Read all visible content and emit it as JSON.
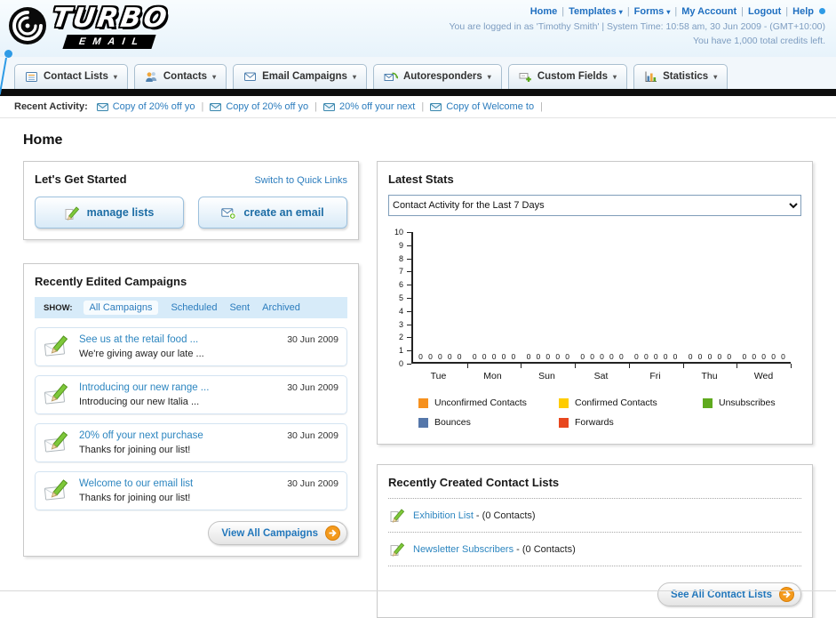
{
  "header": {
    "logo": {
      "title": "TURBO",
      "subtitle": "EMAIL"
    },
    "links": [
      {
        "label": "Home"
      },
      {
        "label": "Templates",
        "dropdown": true
      },
      {
        "label": "Forms",
        "dropdown": true
      },
      {
        "label": "My Account"
      },
      {
        "label": "Logout"
      },
      {
        "label": "Help"
      }
    ],
    "login_info": "You are logged in as 'Timothy Smith' | System Time: 10:58 am, 30 Jun 2009 - (GMT+10:00)",
    "credits_info": "You have 1,000 total credits left."
  },
  "nav": {
    "items": [
      {
        "label": "Contact Lists",
        "icon": "contact-lists"
      },
      {
        "label": "Contacts",
        "icon": "contacts"
      },
      {
        "label": "Email Campaigns",
        "icon": "email-campaigns"
      },
      {
        "label": "Autoresponders",
        "icon": "autoresponders"
      },
      {
        "label": "Custom Fields",
        "icon": "custom-fields"
      },
      {
        "label": "Statistics",
        "icon": "statistics"
      }
    ]
  },
  "recent_activity": {
    "label": "Recent Activity:",
    "items": [
      "Copy of 20% off yo",
      "Copy of 20% off yo",
      "20% off your next",
      "Copy of Welcome to"
    ]
  },
  "page_title": "Home",
  "get_started": {
    "title": "Let's Get Started",
    "switch_link": "Switch to Quick Links",
    "buttons": [
      {
        "label": "manage lists",
        "icon": "pencil",
        "name": "manage-lists"
      },
      {
        "label": "create an email",
        "icon": "envelope-plus",
        "name": "create-an-email"
      }
    ]
  },
  "campaigns": {
    "title": "Recently Edited Campaigns",
    "show_label": "SHOW:",
    "tabs": [
      "All Campaigns",
      "Scheduled",
      "Sent",
      "Archived"
    ],
    "items": [
      {
        "title": "See us at the retail food ...",
        "subtitle": "We're giving away our late ...",
        "date": "30 Jun 2009"
      },
      {
        "title": "Introducing our new range ...",
        "subtitle": "Introducing our new Italia ...",
        "date": "30 Jun 2009"
      },
      {
        "title": "20% off your next purchase",
        "subtitle": "Thanks for joining our list!",
        "date": "30 Jun 2009"
      },
      {
        "title": "Welcome to our email list",
        "subtitle": "Thanks for joining our list!",
        "date": "30 Jun 2009"
      }
    ],
    "view_all_label": "View All Campaigns"
  },
  "stats": {
    "title": "Latest Stats",
    "dropdown_value": "Contact Activity for the Last 7 Days",
    "chart_data": {
      "type": "bar",
      "title": "Contact Activity for the Last 7 Days",
      "categories": [
        "Tue",
        "Mon",
        "Sun",
        "Sat",
        "Fri",
        "Thu",
        "Wed"
      ],
      "series": [
        {
          "name": "Unconfirmed Contacts",
          "color": "#f6911e",
          "values": [
            0,
            0,
            0,
            0,
            0,
            0,
            0
          ]
        },
        {
          "name": "Confirmed Contacts",
          "color": "#ffcc00",
          "values": [
            0,
            0,
            0,
            0,
            0,
            0,
            0
          ]
        },
        {
          "name": "Unsubscribes",
          "color": "#5faa1e",
          "values": [
            0,
            0,
            0,
            0,
            0,
            0,
            0
          ]
        },
        {
          "name": "Bounces",
          "color": "#5577aa",
          "values": [
            0,
            0,
            0,
            0,
            0,
            0,
            0
          ]
        },
        {
          "name": "Forwards",
          "color": "#e8471e",
          "values": [
            0,
            0,
            0,
            0,
            0,
            0,
            0
          ]
        }
      ],
      "ylim": [
        0,
        10
      ],
      "yticks": [
        0,
        1,
        2,
        3,
        4,
        5,
        6,
        7,
        8,
        9,
        10
      ],
      "grid": false,
      "legend_position": "bottom"
    }
  },
  "contact_lists": {
    "title": "Recently Created Contact Lists",
    "items": [
      {
        "name": "Exhibition List",
        "count_text": "(0 Contacts)"
      },
      {
        "name": "Newsletter Subscribers",
        "count_text": "(0 Contacts)"
      }
    ],
    "see_all_label": "See All Contact Lists"
  },
  "colors": {
    "link_blue": "#2b7cbd",
    "accent_orange": "#f49a1c",
    "nav_bar_black": "#0d0d0d",
    "decoration_blue": "#2e9be6"
  }
}
